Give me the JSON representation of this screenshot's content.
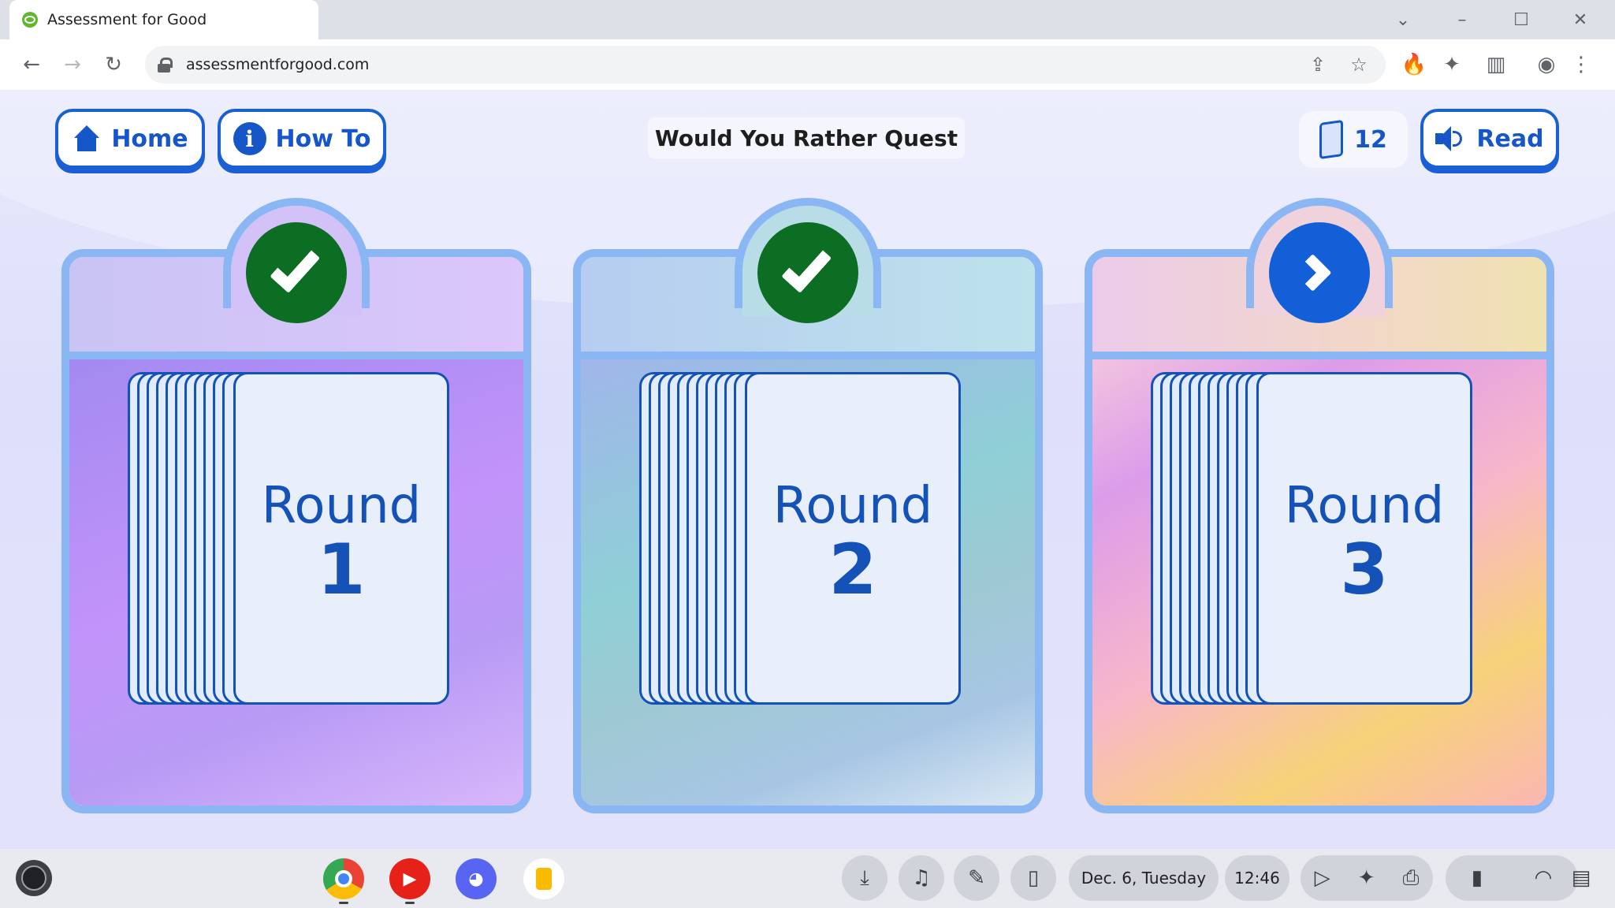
{
  "browser": {
    "tab_title": "Assessment for Good",
    "url": "assessmentforgood.com",
    "window_controls": [
      "chevron-down-icon",
      "minimize-icon",
      "maximize-icon",
      "close-icon"
    ]
  },
  "page": {
    "home_label": "Home",
    "howto_label": "How To",
    "title": "Would You Rather Quest",
    "card_count": "12",
    "read_label": "Read",
    "rounds": [
      {
        "word": "Round",
        "number": "1",
        "status": "completed"
      },
      {
        "word": "Round",
        "number": "2",
        "status": "completed"
      },
      {
        "word": "Round",
        "number": "3",
        "status": "next"
      }
    ]
  },
  "shelf": {
    "apps": [
      "Chrome",
      "YouTube Music",
      "Discord",
      "Google Keep"
    ],
    "date": "Dec. 6, Tuesday",
    "time": "12:46"
  },
  "colors": {
    "accent_blue": "#1656c9",
    "completed_green": "#0b6e22",
    "frame_blue": "#8ab7f4"
  }
}
